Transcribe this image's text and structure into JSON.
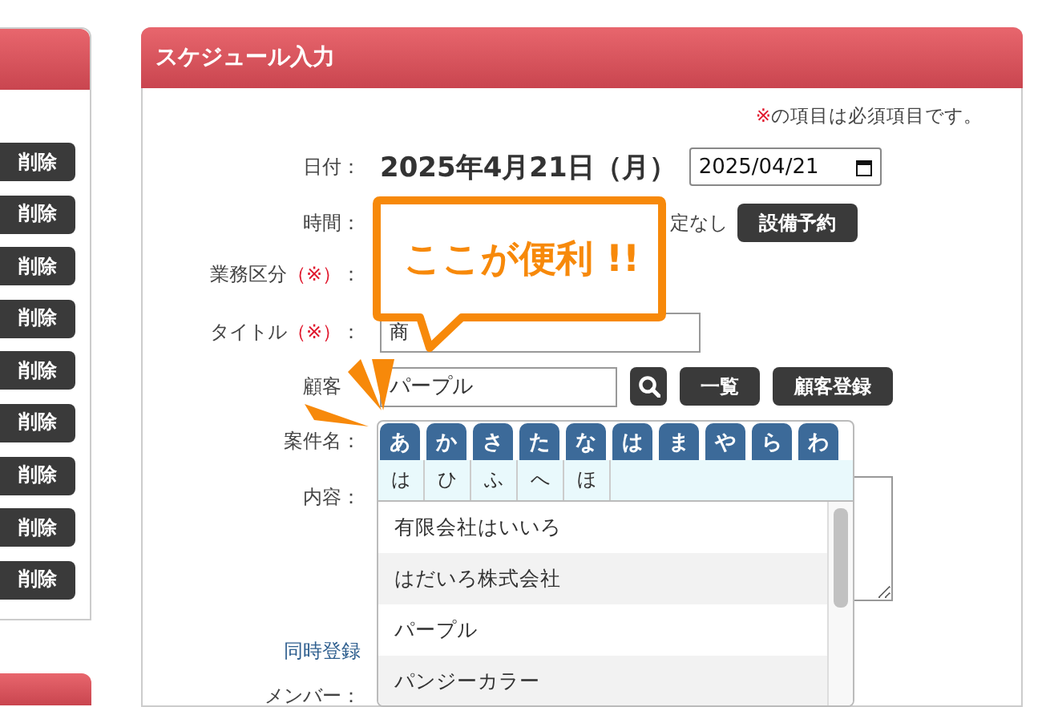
{
  "side_panel": {
    "buttons": [
      "削除",
      "削除",
      "削除",
      "削除",
      "削除",
      "削除",
      "削除",
      "削除",
      "削除"
    ]
  },
  "form": {
    "title": "スケジュール入力",
    "note": {
      "mark": "※",
      "text": "の項目は必須項目です。"
    },
    "rows": [
      {
        "kind": "date",
        "label": "日付：",
        "value": "2025年4月21日（月）",
        "input": "2025/04/21"
      },
      {
        "kind": "time",
        "label": "時間：",
        "text": "定なし",
        "button": "設備予約"
      },
      {
        "kind": "blank",
        "label": "業務区分",
        "mark": "（※）",
        "suffix": "："
      },
      {
        "kind": "text",
        "label": "タイトル",
        "mark": "（※）",
        "suffix": "：",
        "value": "商"
      },
      {
        "kind": "customer",
        "label": "顧客",
        "value": "パープル",
        "buttons": [
          "一覧",
          "顧客登録"
        ]
      },
      {
        "kind": "blank",
        "label": "案件名："
      },
      {
        "kind": "textarea",
        "label": "内容："
      },
      {
        "kind": "link",
        "label": "同時登録"
      },
      {
        "kind": "blank",
        "label": "メンバー："
      }
    ]
  },
  "picker": {
    "tabs": [
      "あ",
      "か",
      "さ",
      "た",
      "な",
      "は",
      "ま",
      "や",
      "ら",
      "わ"
    ],
    "subtabs": [
      "は",
      "ひ",
      "ふ",
      "へ",
      "ほ"
    ],
    "items": [
      "有限会社はいいろ",
      "はだいろ株式会社",
      "パープル",
      "パンジーカラー"
    ]
  },
  "callout": {
    "text": "ここが便利 !!"
  }
}
